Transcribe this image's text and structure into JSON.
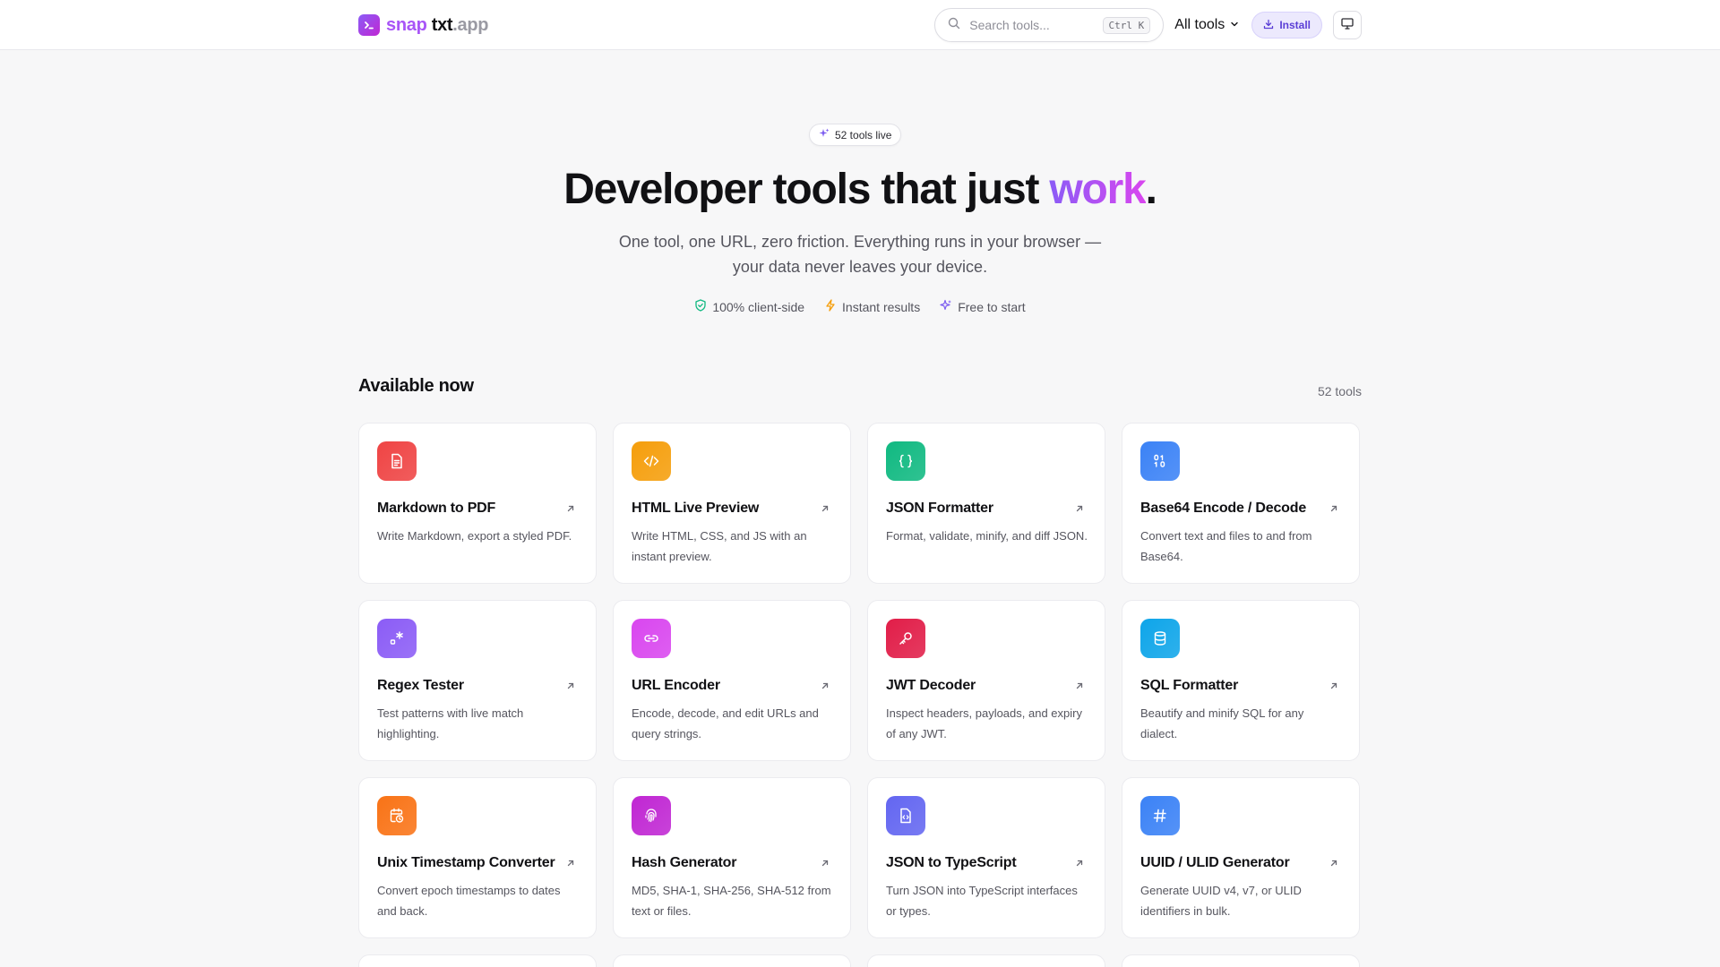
{
  "brand": {
    "part1": "snap",
    "part2": "txt",
    "part3": ".app"
  },
  "header": {
    "search_placeholder": "Search tools...",
    "search_shortcut": "Ctrl K",
    "all_tools_label": "All tools",
    "install_label": "Install"
  },
  "hero": {
    "badge": "52 tools live",
    "headline_main": "Developer tools that just ",
    "headline_accent": "work",
    "headline_end": ".",
    "sub_line1": "One tool, one URL, zero friction. Everything runs in your browser —",
    "sub_line2": "your data never leaves your device.",
    "features": [
      "100% client-side",
      "Instant results",
      "Free to start"
    ]
  },
  "section": {
    "title": "Available now",
    "count": "52 tools"
  },
  "tools": [
    {
      "title": "Markdown to PDF",
      "desc": "Write Markdown, export a styled PDF.",
      "icon": "document-icon",
      "color": "#ef4444"
    },
    {
      "title": "HTML Live Preview",
      "desc": "Write HTML, CSS, and JS with an instant preview.",
      "icon": "code-icon",
      "color": "#f59e0b"
    },
    {
      "title": "JSON Formatter",
      "desc": "Format, validate, minify, and diff JSON.",
      "icon": "braces-icon",
      "color": "#10b981"
    },
    {
      "title": "Base64 Encode / Decode",
      "desc": "Convert text and files to and from Base64.",
      "icon": "binary-icon",
      "color": "#3b82f6"
    },
    {
      "title": "Regex Tester",
      "desc": "Test patterns with live match highlighting.",
      "icon": "regex-icon",
      "color": "#8b5cf6"
    },
    {
      "title": "URL Encoder",
      "desc": "Encode, decode, and edit URLs and query strings.",
      "icon": "link-icon",
      "color": "#d946ef"
    },
    {
      "title": "JWT Decoder",
      "desc": "Inspect headers, payloads, and expiry of any JWT.",
      "icon": "key-icon",
      "color": "#e11d48"
    },
    {
      "title": "SQL Formatter",
      "desc": "Beautify and minify SQL for any dialect.",
      "icon": "database-icon",
      "color": "#0ea5e9"
    },
    {
      "title": "Unix Timestamp Converter",
      "desc": "Convert epoch timestamps to dates and back.",
      "icon": "calendar-clock-icon",
      "color": "#f97316"
    },
    {
      "title": "Hash Generator",
      "desc": "MD5, SHA-1, SHA-256, SHA-512 from text or files.",
      "icon": "fingerprint-icon",
      "color": "#c026d3"
    },
    {
      "title": "JSON to TypeScript",
      "desc": "Turn JSON into TypeScript interfaces or types.",
      "icon": "file-code-icon",
      "color": "#6366f1"
    },
    {
      "title": "UUID / ULID Generator",
      "desc": "Generate UUID v4, v7, or ULID identifiers in bulk.",
      "icon": "hash-icon",
      "color": "#3b82f6"
    }
  ]
}
